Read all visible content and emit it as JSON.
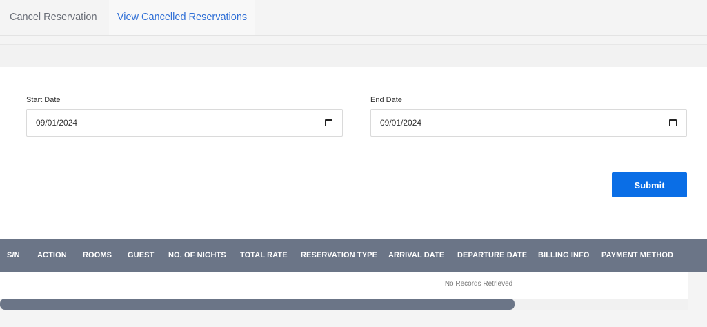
{
  "tabs": [
    {
      "label": "Cancel Reservation",
      "active": false
    },
    {
      "label": "View Cancelled Reservations",
      "active": true
    }
  ],
  "filters": {
    "start_date": {
      "label": "Start Date",
      "value": "09/01/2024"
    },
    "end_date": {
      "label": "End Date",
      "value": "09/01/2024"
    },
    "submit_label": "Submit"
  },
  "table": {
    "columns": [
      "S/N",
      "ACTION",
      "ROOMS",
      "GUEST",
      "NO. OF NIGHTS",
      "TOTAL RATE",
      "RESERVATION TYPE",
      "ARRIVAL DATE",
      "DEPARTURE DATE",
      "BILLING INFO",
      "PAYMENT METHOD",
      ""
    ],
    "empty_message": "No Records Retrieved"
  },
  "colors": {
    "accent": "#0a6ee6",
    "active_tab_text": "#2f6fd6",
    "table_header": "#6b7587"
  },
  "icons": {
    "date_picker": "calendar-icon"
  }
}
